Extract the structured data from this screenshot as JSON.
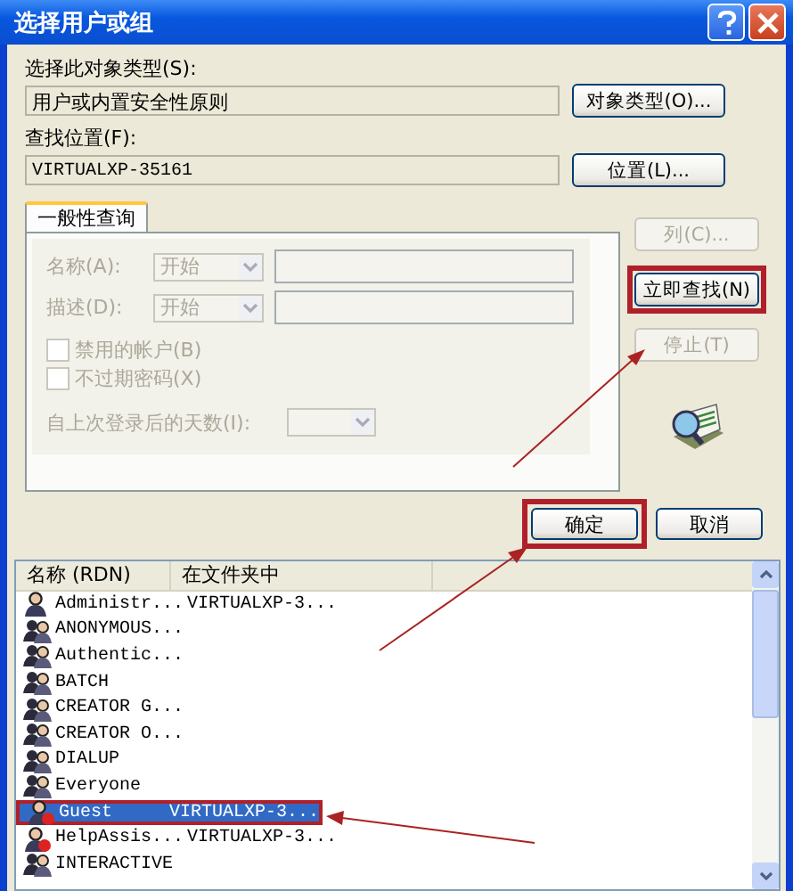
{
  "window": {
    "title": "选择用户或组"
  },
  "object_type": {
    "label": "选择此对象类型(S):",
    "value": "用户或内置安全性原则",
    "button": "对象类型(O)..."
  },
  "location": {
    "label": "查找位置(F):",
    "value": "VIRTUALXP-35161",
    "button": "位置(L)..."
  },
  "tabs": [
    {
      "label": "一般性查询",
      "selected": true
    }
  ],
  "query": {
    "disabled": true,
    "name_label": "名称(A):",
    "name_mode": "开始",
    "desc_label": "描述(D):",
    "desc_mode": "开始",
    "checkboxes": [
      {
        "label": "禁用的帐户(B)",
        "checked": false
      },
      {
        "label": "不过期密码(X)",
        "checked": false
      }
    ],
    "days_label": "自上次登录后的天数(I):"
  },
  "side_buttons": [
    {
      "label": "列(C)...",
      "disabled": true,
      "highlighted": false
    },
    {
      "label": "立即查找(N)",
      "disabled": false,
      "highlighted": true
    },
    {
      "label": "停止(T)",
      "disabled": true,
      "highlighted": false
    }
  ],
  "dialog_buttons": [
    {
      "label": "确定",
      "highlighted": true
    },
    {
      "label": "取消",
      "highlighted": false
    }
  ],
  "results": {
    "columns": [
      "名称 (RDN)",
      "在文件夹中"
    ],
    "rows": [
      {
        "kind": "user",
        "name": "Administr...",
        "folder": "VIRTUALXP-3...",
        "disabled": false,
        "selected": false,
        "highlighted": false
      },
      {
        "kind": "group",
        "name": "ANONYMOUS...",
        "disabled": false,
        "selected": false,
        "highlighted": false
      },
      {
        "kind": "group",
        "name": "Authentic...",
        "disabled": false,
        "selected": false,
        "highlighted": false
      },
      {
        "kind": "group",
        "name": "BATCH",
        "disabled": false,
        "selected": false,
        "highlighted": false
      },
      {
        "kind": "group",
        "name": "CREATOR G...",
        "disabled": false,
        "selected": false,
        "highlighted": false
      },
      {
        "kind": "group",
        "name": "CREATOR O...",
        "disabled": false,
        "selected": false,
        "highlighted": false
      },
      {
        "kind": "group",
        "name": "DIALUP",
        "disabled": false,
        "selected": false,
        "highlighted": false
      },
      {
        "kind": "group",
        "name": "Everyone",
        "disabled": false,
        "selected": false,
        "highlighted": false
      },
      {
        "kind": "user",
        "name": "Guest",
        "folder": "VIRTUALXP-3...",
        "disabled": true,
        "selected": true,
        "highlighted": true
      },
      {
        "kind": "user",
        "name": "HelpAssis...",
        "folder": "VIRTUALXP-3...",
        "disabled": true,
        "selected": false,
        "highlighted": false
      },
      {
        "kind": "group",
        "name": "INTERACTIVE",
        "disabled": false,
        "selected": false,
        "highlighted": false
      }
    ]
  }
}
